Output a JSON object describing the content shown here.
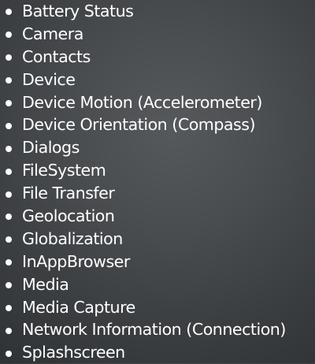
{
  "plugins": {
    "items": [
      {
        "label": "Battery Status"
      },
      {
        "label": "Camera"
      },
      {
        "label": "Contacts"
      },
      {
        "label": "Device"
      },
      {
        "label": "Device Motion (Accelerometer)"
      },
      {
        "label": "Device Orientation (Compass)"
      },
      {
        "label": "Dialogs"
      },
      {
        "label": "FileSystem"
      },
      {
        "label": "File Transfer"
      },
      {
        "label": "Geolocation"
      },
      {
        "label": "Globalization"
      },
      {
        "label": "InAppBrowser"
      },
      {
        "label": "Media"
      },
      {
        "label": "Media Capture"
      },
      {
        "label": "Network Information (Connection)"
      },
      {
        "label": "Splashscreen"
      }
    ]
  }
}
